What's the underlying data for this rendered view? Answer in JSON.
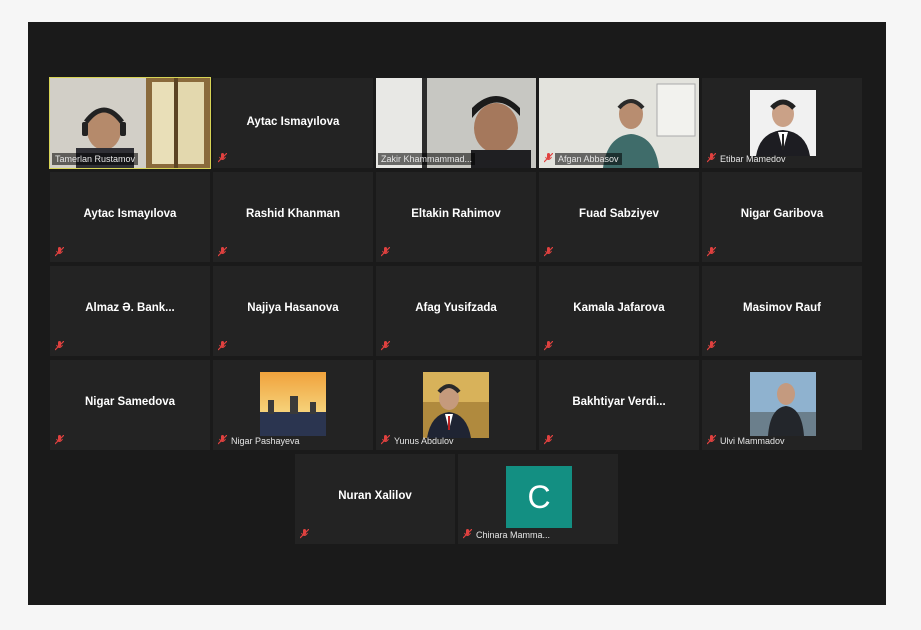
{
  "colors": {
    "window_bg": "#1a1a1a",
    "tile_bg": "#232323",
    "active_speaker": "#d7d455",
    "muted_icon": "#e0413f",
    "avatar_teal": "#138f82"
  },
  "participants": [
    {
      "name": "Tamerlan Rustamov",
      "muted": false,
      "video": true,
      "active": true
    },
    {
      "name": "Aytac İsmayılova",
      "muted": true,
      "video": false
    },
    {
      "name": "Zakir Khammammad...",
      "muted": false,
      "video": true
    },
    {
      "name": "Afgan Abbasov",
      "muted": true,
      "video": true
    },
    {
      "name": "Etibar Mamedov",
      "muted": true,
      "video": false,
      "photo": true
    },
    {
      "name": "Aytac İsmayılova",
      "muted": true,
      "video": false
    },
    {
      "name": "Rashid Khanman",
      "muted": true,
      "video": false
    },
    {
      "name": "Eltakin Rahimov",
      "muted": true,
      "video": false
    },
    {
      "name": "Fuad Sabziyev",
      "muted": true,
      "video": false
    },
    {
      "name": "Nigar Garibova",
      "muted": true,
      "video": false
    },
    {
      "name": "Almaz Ə. Bank...",
      "muted": true,
      "video": false
    },
    {
      "name": "Najiya Hasanova",
      "muted": true,
      "video": false
    },
    {
      "name": "Afag Yusifzada",
      "muted": true,
      "video": false
    },
    {
      "name": "Kamala Jafarova",
      "muted": true,
      "video": false
    },
    {
      "name": "Masimov Rauf",
      "muted": true,
      "video": false
    },
    {
      "name": "Nigar Samedova",
      "muted": true,
      "video": false
    },
    {
      "name": "Nigar Pashayeva",
      "muted": true,
      "video": false,
      "photo": true
    },
    {
      "name": "Yunus Abdulov",
      "muted": true,
      "video": false,
      "photo": true
    },
    {
      "name": "Bakhtiyar  Verdi...",
      "muted": true,
      "video": false
    },
    {
      "name": "Ulvi Mammadov",
      "muted": true,
      "video": false,
      "photo": true
    },
    {
      "name": "Nuran Xalilov",
      "muted": true,
      "video": false
    },
    {
      "name": "Chinara Mamma...",
      "muted": true,
      "video": false,
      "avatar_letter": "C"
    }
  ]
}
